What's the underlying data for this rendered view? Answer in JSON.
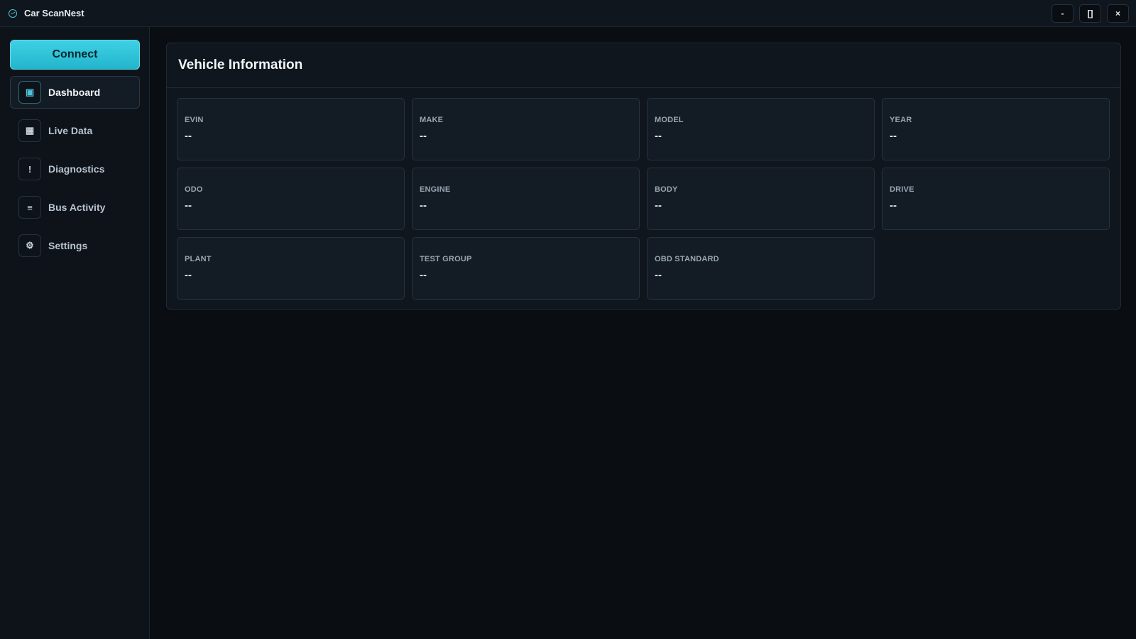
{
  "app": {
    "title": "Car ScanNest"
  },
  "window_controls": {
    "minimize": "-",
    "maximize": "[]",
    "close": "×"
  },
  "sidebar": {
    "connect_label": "Connect",
    "items": [
      {
        "label": "Dashboard",
        "icon": "dashboard-icon",
        "glyph": "▣",
        "active": true
      },
      {
        "label": "Live Data",
        "icon": "grid-icon",
        "glyph": "▦",
        "active": false
      },
      {
        "label": "Diagnostics",
        "icon": "alert-icon",
        "glyph": "!",
        "active": false
      },
      {
        "label": "Bus Activity",
        "icon": "list-icon",
        "glyph": "≡",
        "active": false
      },
      {
        "label": "Settings",
        "icon": "gear-icon",
        "glyph": "⚙",
        "active": false
      }
    ]
  },
  "main": {
    "title": "Vehicle Information",
    "fields": [
      {
        "label": "EVIN",
        "value": "--"
      },
      {
        "label": "MAKE",
        "value": "--"
      },
      {
        "label": "MODEL",
        "value": "--"
      },
      {
        "label": "YEAR",
        "value": "--"
      },
      {
        "label": "ODO",
        "value": "--"
      },
      {
        "label": "ENGINE",
        "value": "--"
      },
      {
        "label": "BODY",
        "value": "--"
      },
      {
        "label": "DRIVE",
        "value": "--"
      },
      {
        "label": "PLANT",
        "value": "--"
      },
      {
        "label": "TEST GROUP",
        "value": "--"
      },
      {
        "label": "OBD STANDARD",
        "value": "--"
      }
    ]
  },
  "colors": {
    "accent": "#3fd0e4",
    "background": "#0a0e13",
    "panel": "#0f161d",
    "card": "#131c25"
  }
}
